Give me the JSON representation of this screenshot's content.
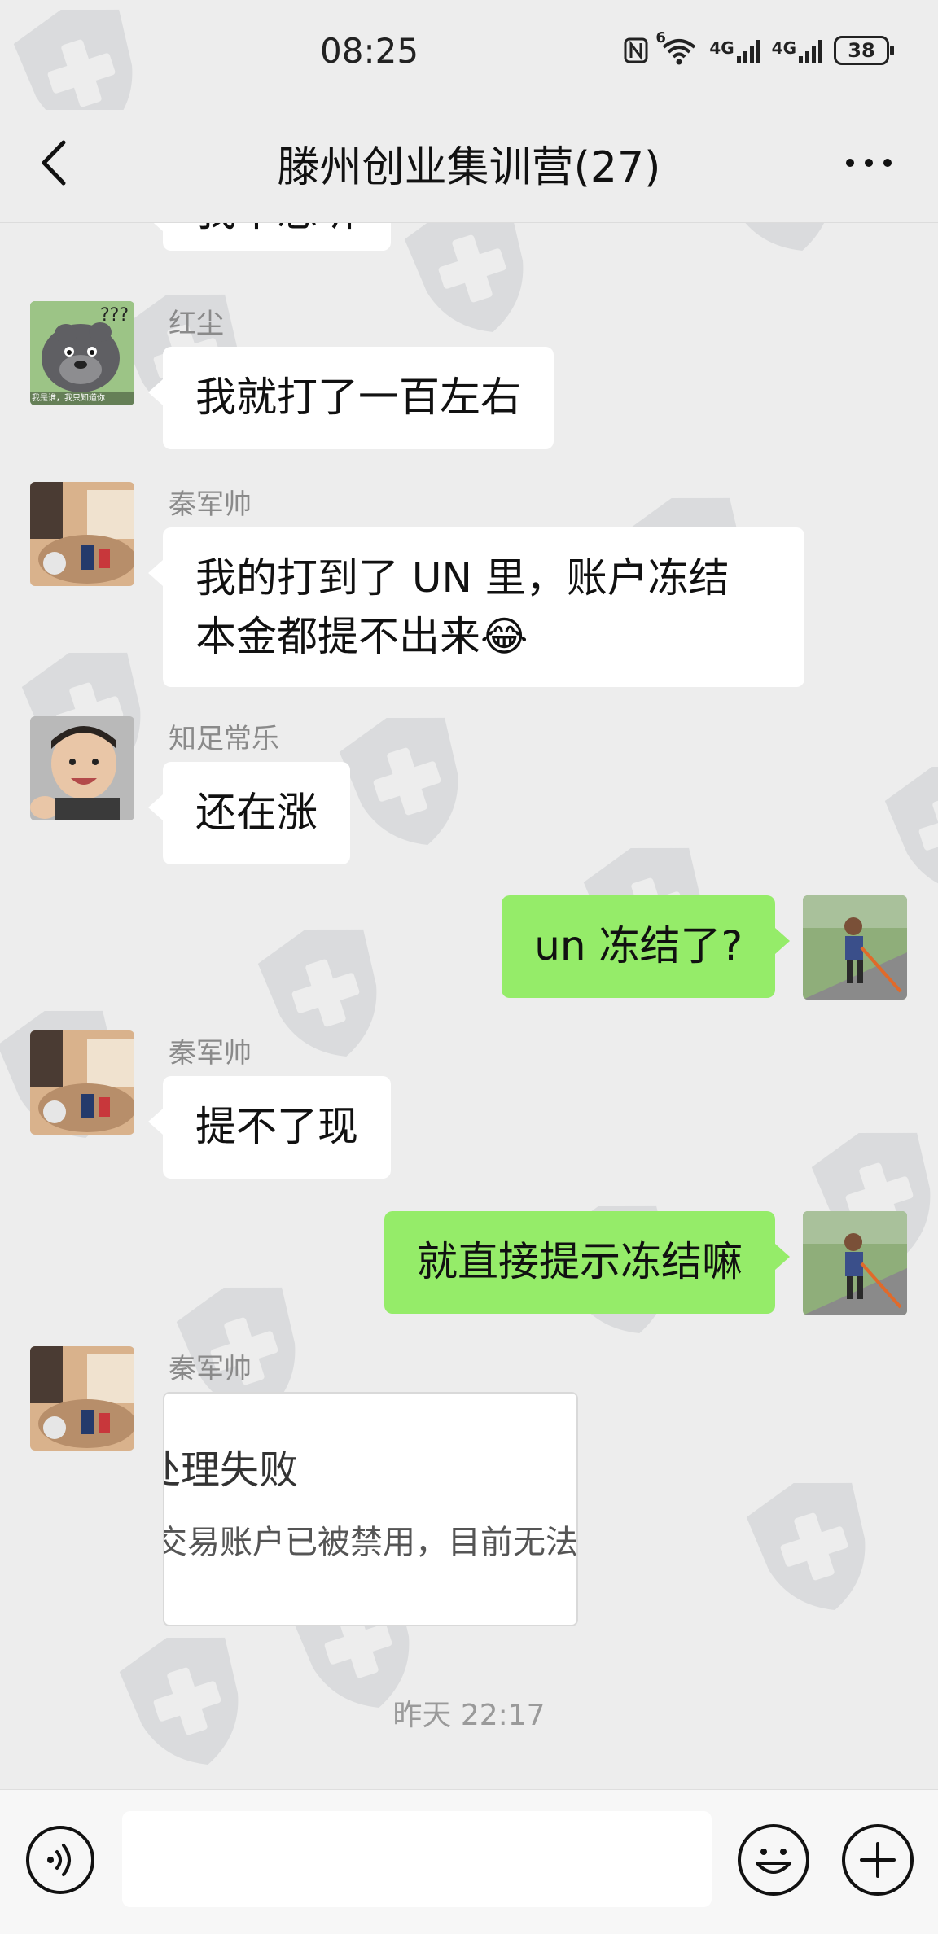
{
  "status_bar": {
    "time": "08:25",
    "signal_1": "4G",
    "signal_2": "4G",
    "wifi_badge": "6",
    "battery": "38"
  },
  "header": {
    "title": "滕州创业集训营(27)",
    "back_icon": "chevron-left-icon",
    "more_icon": "more-dots-icon"
  },
  "messages": [
    {
      "side": "left",
      "sender": "",
      "text": "我不总听"
    },
    {
      "side": "left",
      "sender": "红尘",
      "text": "我就打了一百左右"
    },
    {
      "side": "left",
      "sender": "秦军帅",
      "line1": "我的打到了 UN 里，账户冻结",
      "line2": "本金都提不出来😂"
    },
    {
      "side": "left",
      "sender": "知足常乐",
      "text": "还在涨"
    },
    {
      "side": "right",
      "text": "un 冻结了?"
    },
    {
      "side": "left",
      "sender": "秦军帅",
      "text": "提不了现"
    },
    {
      "side": "right",
      "text": "就直接提示冻结嘛"
    },
    {
      "side": "left",
      "sender": "秦军帅",
      "card_title": "处理失败",
      "card_body": "交易账户已被禁用，目前无法"
    }
  ],
  "avatar_caption": "我是谁，我只知道你",
  "timestamp": "昨天 22:17",
  "input_bar": {
    "placeholder": "",
    "voice_icon": "voice-icon",
    "emoji_icon": "emoji-icon",
    "plus_icon": "plus-icon"
  },
  "colors": {
    "background": "#ededed",
    "incoming_bubble": "#ffffff",
    "outgoing_bubble": "#95ec69",
    "watermark": "#9aa0a6"
  }
}
